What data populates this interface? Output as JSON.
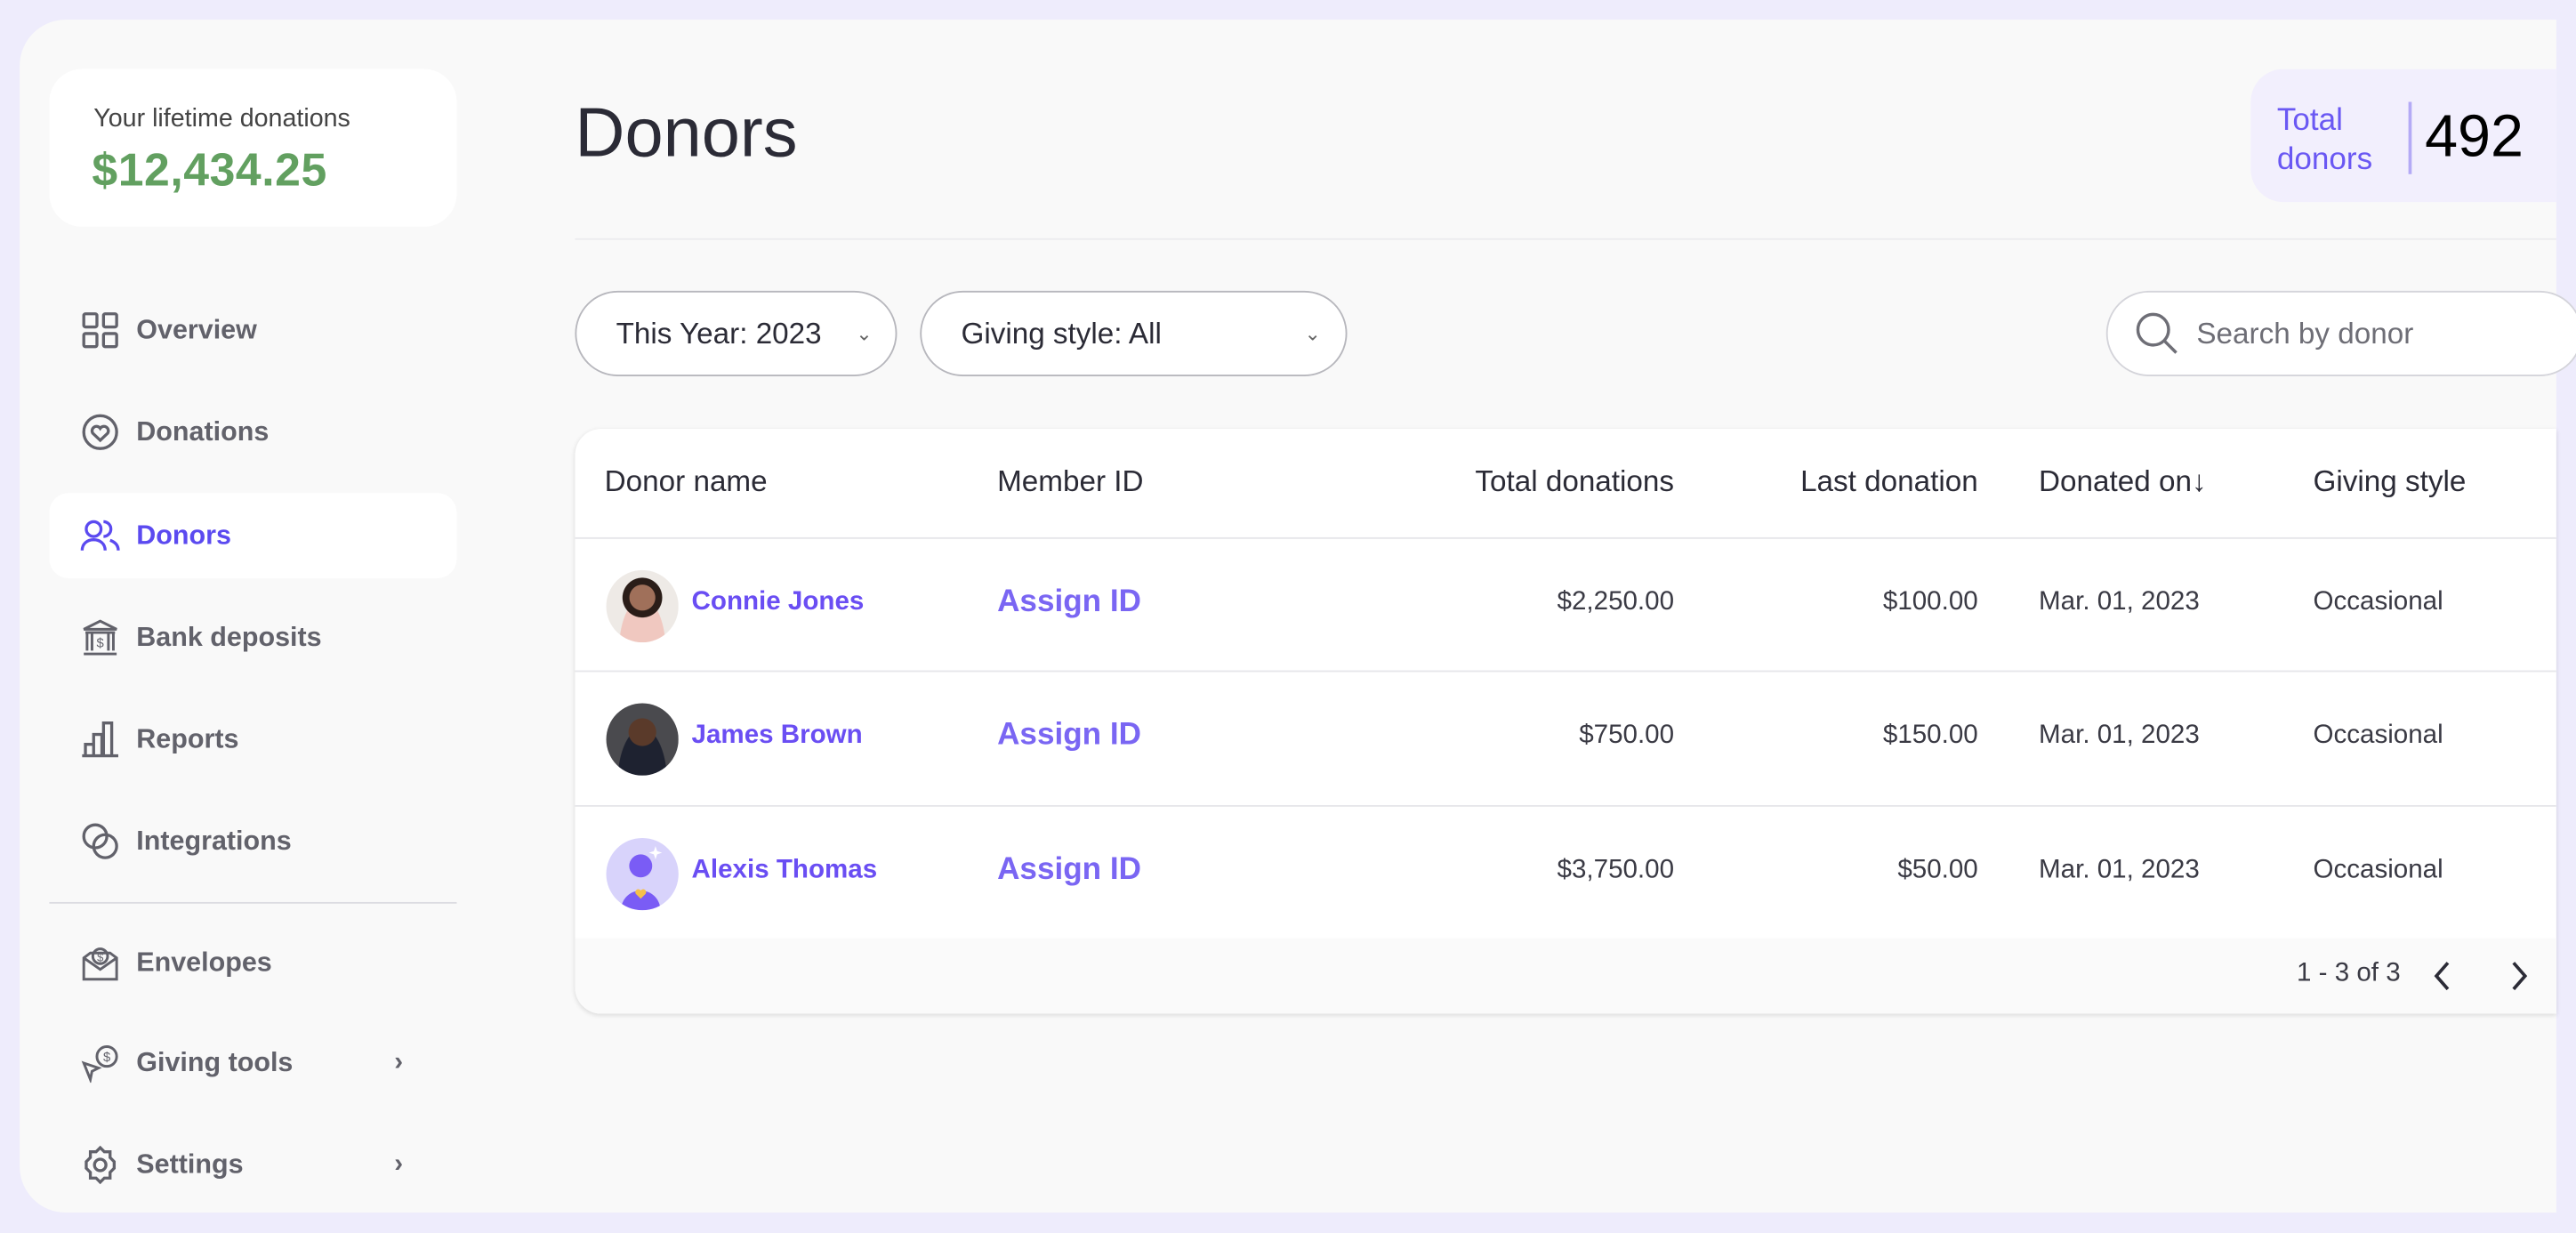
{
  "sidebar": {
    "lifetime_label": "Your lifetime donations",
    "lifetime_value": "$12,434.25",
    "items": [
      {
        "label": "Overview",
        "icon": "grid-icon"
      },
      {
        "label": "Donations",
        "icon": "heart-circle-icon"
      },
      {
        "label": "Donors",
        "icon": "users-icon",
        "active": true
      },
      {
        "label": "Bank deposits",
        "icon": "bank-icon"
      },
      {
        "label": "Reports",
        "icon": "bar-chart-icon"
      },
      {
        "label": "Integrations",
        "icon": "integrations-icon"
      },
      {
        "label": "Envelopes",
        "icon": "envelope-dollar-icon"
      },
      {
        "label": "Giving tools",
        "icon": "giving-tools-icon",
        "chevron": "›"
      },
      {
        "label": "Settings",
        "icon": "gear-icon",
        "chevron": "›"
      }
    ]
  },
  "header": {
    "title": "Donors",
    "total_label": "Total donors",
    "total_value": "492"
  },
  "filters": {
    "year": "This Year: 2023",
    "giving_style": "Giving style: All",
    "caret": "⌄",
    "search_placeholder": "Search by donor"
  },
  "table": {
    "columns": [
      "Donor name",
      "Member ID",
      "Total donations",
      "Last donation",
      "Donated on↓",
      "Giving style"
    ],
    "rows": [
      {
        "name": "Connie Jones",
        "member_id": "Assign ID",
        "total": "$2,250.00",
        "last": "$100.00",
        "date": "Mar. 01, 2023",
        "style": "Occasional"
      },
      {
        "name": "James Brown",
        "member_id": "Assign ID",
        "total": "$750.00",
        "last": "$150.00",
        "date": "Mar. 01, 2023",
        "style": "Occasional"
      },
      {
        "name": "Alexis Thomas",
        "member_id": "Assign ID",
        "total": "$3,750.00",
        "last": "$50.00",
        "date": "Mar. 01, 2023",
        "style": "Occasional"
      }
    ],
    "pagination": "1 - 3 of 3"
  },
  "colors": {
    "accent": "#6a4ef3",
    "lifetime_green": "#62a060",
    "background": "#eeecfc"
  }
}
